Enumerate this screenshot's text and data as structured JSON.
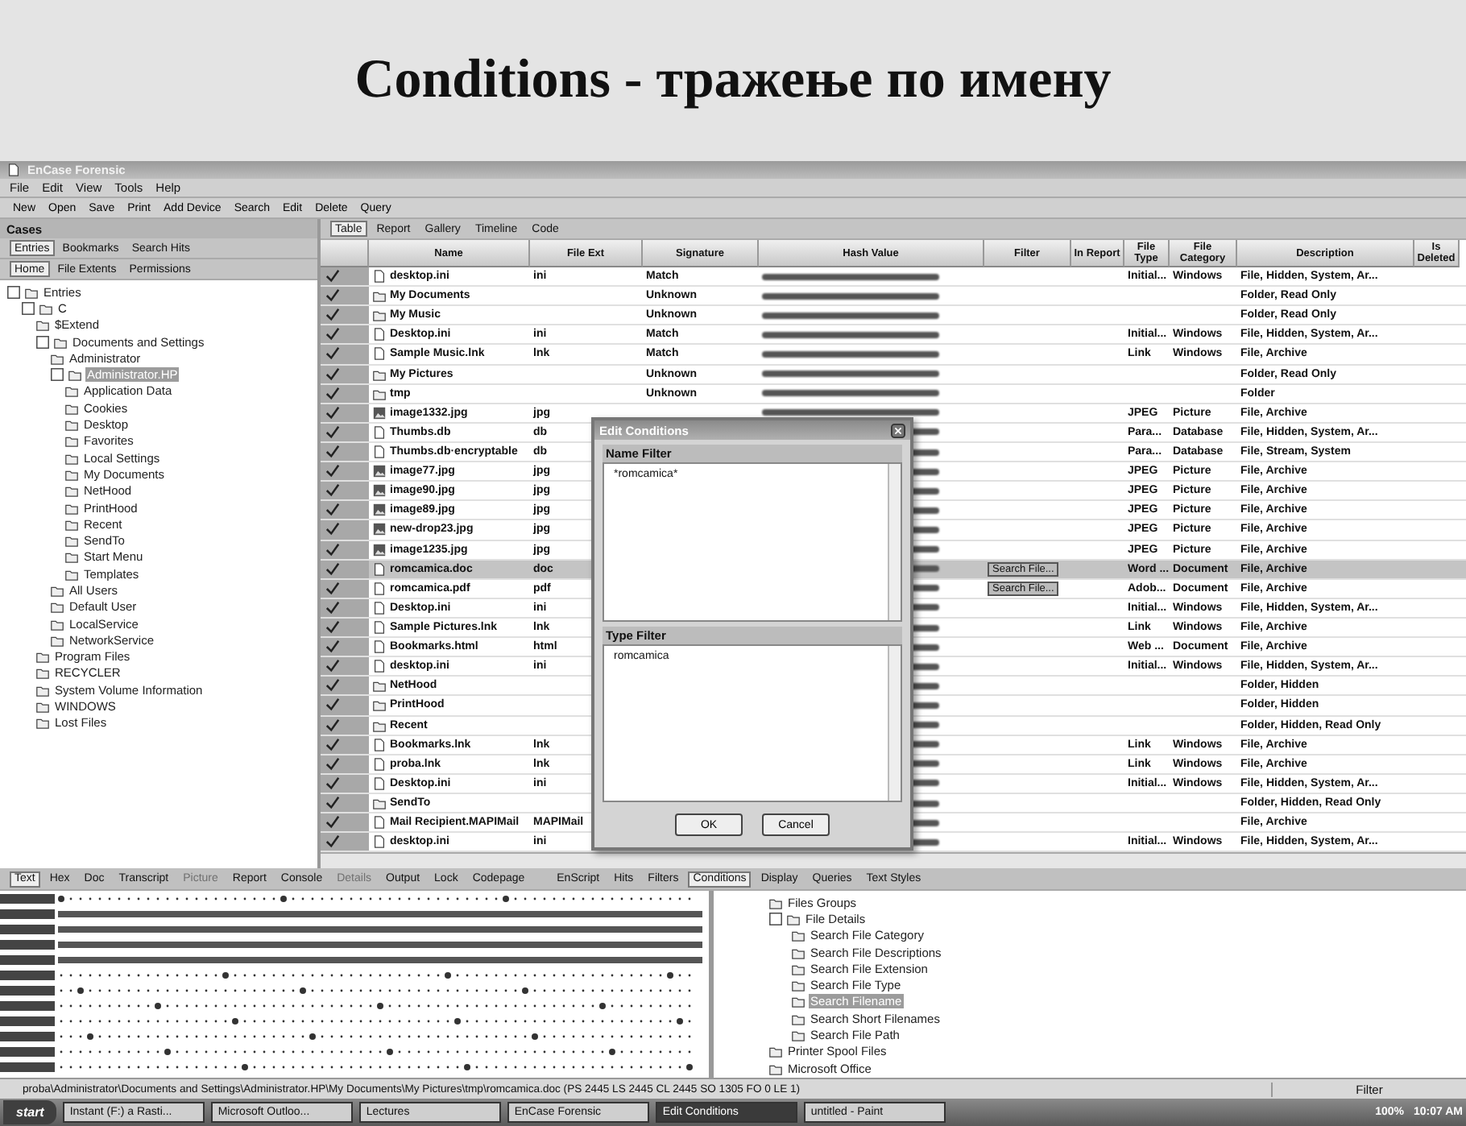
{
  "slide_title": "Conditions - тражење по имену",
  "window": {
    "title": "EnCase Forensic"
  },
  "menu": [
    "File",
    "Edit",
    "View",
    "Tools",
    "Help"
  ],
  "toolbar": [
    "New",
    "Open",
    "Save",
    "Print",
    "Add Device",
    "Search",
    "Edit",
    "Delete",
    "Query"
  ],
  "left_panel": {
    "header": "Cases",
    "tabs_1": [
      {
        "label": "Entries",
        "selected": true
      },
      {
        "label": "Bookmarks",
        "selected": false
      },
      {
        "label": "Search Hits",
        "selected": false
      }
    ],
    "tabs_2": [
      {
        "label": "Home",
        "selected": true
      },
      {
        "label": "File Extents",
        "selected": false
      },
      {
        "label": "Permissions",
        "selected": false
      }
    ],
    "tree": [
      {
        "label": "Entries",
        "selected": false,
        "children": [
          {
            "label": "C",
            "selected": false,
            "children": [
              {
                "label": "$Extend",
                "selected": false
              },
              {
                "label": "Documents and Settings",
                "selected": false,
                "children": [
                  {
                    "label": "Administrator",
                    "selected": false
                  },
                  {
                    "label": "Administrator.HP",
                    "selected": true,
                    "children": [
                      {
                        "label": "Application Data",
                        "selected": false
                      },
                      {
                        "label": "Cookies",
                        "selected": false
                      },
                      {
                        "label": "Desktop",
                        "selected": false
                      },
                      {
                        "label": "Favorites",
                        "selected": false
                      },
                      {
                        "label": "Local Settings",
                        "selected": false
                      },
                      {
                        "label": "My Documents",
                        "selected": false
                      },
                      {
                        "label": "NetHood",
                        "selected": false
                      },
                      {
                        "label": "PrintHood",
                        "selected": false
                      },
                      {
                        "label": "Recent",
                        "selected": false
                      },
                      {
                        "label": "SendTo",
                        "selected": false
                      },
                      {
                        "label": "Start Menu",
                        "selected": false
                      },
                      {
                        "label": "Templates",
                        "selected": false
                      }
                    ]
                  },
                  {
                    "label": "All Users",
                    "selected": false
                  },
                  {
                    "label": "Default User",
                    "selected": false
                  },
                  {
                    "label": "LocalService",
                    "selected": false
                  },
                  {
                    "label": "NetworkService",
                    "selected": false
                  }
                ]
              },
              {
                "label": "Program Files",
                "selected": false
              },
              {
                "label": "RECYCLER",
                "selected": false
              },
              {
                "label": "System Volume Information",
                "selected": false
              },
              {
                "label": "WINDOWS",
                "selected": false
              },
              {
                "label": "Lost Files",
                "selected": false
              }
            ]
          }
        ]
      }
    ]
  },
  "view_tabs": [
    {
      "label": "Table",
      "selected": true
    },
    {
      "label": "Report",
      "selected": false
    },
    {
      "label": "Gallery",
      "selected": false
    },
    {
      "label": "Timeline",
      "selected": false
    },
    {
      "label": "Code",
      "selected": false
    }
  ],
  "table": {
    "columns": [
      "Name",
      "File Ext",
      "Signature",
      "Hash Value",
      "Filter",
      "In Report",
      "File Type",
      "File Category",
      "Description",
      "Is Deleted"
    ],
    "rows": [
      {
        "kind": "file",
        "name": "desktop.ini",
        "ext": "ini",
        "signature": "Match",
        "file_type": "Initial...",
        "category": "Windows",
        "description": "File, Hidden, System, Ar...",
        "selected": false
      },
      {
        "kind": "folder",
        "name": "My Documents",
        "signature": "Unknown",
        "description": "Folder, Read Only",
        "selected": false
      },
      {
        "kind": "folder",
        "name": "My Music",
        "signature": "Unknown",
        "description": "Folder, Read Only",
        "selected": false
      },
      {
        "kind": "file",
        "name": "Desktop.ini",
        "ext": "ini",
        "signature": "Match",
        "file_type": "Initial...",
        "category": "Windows",
        "description": "File, Hidden, System, Ar...",
        "selected": false
      },
      {
        "kind": "file",
        "name": "Sample Music.lnk",
        "ext": "lnk",
        "signature": "Match",
        "file_type": "Link",
        "category": "Windows",
        "description": "File, Archive",
        "selected": false
      },
      {
        "kind": "folder",
        "name": "My Pictures",
        "signature": "Unknown",
        "description": "Folder, Read Only",
        "selected": false
      },
      {
        "kind": "folder",
        "name": "tmp",
        "signature": "Unknown",
        "description": "Folder",
        "selected": false
      },
      {
        "kind": "image",
        "name": "image1332.jpg",
        "ext": "jpg",
        "file_type": "JPEG",
        "category": "Picture",
        "description": "File, Archive",
        "selected": false
      },
      {
        "kind": "file",
        "name": "Thumbs.db",
        "ext": "db",
        "file_type": "Para...",
        "category": "Database",
        "description": "File, Hidden, System, Ar...",
        "selected": false
      },
      {
        "kind": "file",
        "name": "Thumbs.db·encryptable",
        "ext": "db",
        "file_type": "Para...",
        "category": "Database",
        "description": "File, Stream, System",
        "selected": false
      },
      {
        "kind": "image",
        "name": "image77.jpg",
        "ext": "jpg",
        "file_type": "JPEG",
        "category": "Picture",
        "description": "File, Archive",
        "selected": false
      },
      {
        "kind": "image",
        "name": "image90.jpg",
        "ext": "jpg",
        "file_type": "JPEG",
        "category": "Picture",
        "description": "File, Archive",
        "selected": false
      },
      {
        "kind": "image",
        "name": "image89.jpg",
        "ext": "jpg",
        "file_type": "JPEG",
        "category": "Picture",
        "description": "File, Archive",
        "selected": false
      },
      {
        "kind": "image",
        "name": "new-drop23.jpg",
        "ext": "jpg",
        "file_type": "JPEG",
        "category": "Picture",
        "description": "File, Archive",
        "selected": false
      },
      {
        "kind": "image",
        "name": "image1235.jpg",
        "ext": "jpg",
        "file_type": "JPEG",
        "category": "Picture",
        "description": "File, Archive",
        "selected": false
      },
      {
        "kind": "file",
        "name": "romcamica.doc",
        "ext": "doc",
        "filter": "Search File...",
        "file_type": "Word ...",
        "category": "Document",
        "description": "File, Archive",
        "selected": true
      },
      {
        "kind": "file",
        "name": "romcamica.pdf",
        "ext": "pdf",
        "filter": "Search File...",
        "file_type": "Adob...",
        "category": "Document",
        "description": "File, Archive",
        "selected": false
      },
      {
        "kind": "file",
        "name": "Desktop.ini",
        "ext": "ini",
        "file_type": "Initial...",
        "category": "Windows",
        "description": "File, Hidden, System, Ar...",
        "selected": false
      },
      {
        "kind": "file",
        "name": "Sample Pictures.lnk",
        "ext": "lnk",
        "file_type": "Link",
        "category": "Windows",
        "description": "File, Archive",
        "selected": false
      },
      {
        "kind": "file",
        "name": "Bookmarks.html",
        "ext": "html",
        "file_type": "Web ...",
        "category": "Document",
        "description": "File, Archive",
        "selected": false
      },
      {
        "kind": "file",
        "name": "desktop.ini",
        "ext": "ini",
        "file_type": "Initial...",
        "category": "Windows",
        "description": "File, Hidden, System, Ar...",
        "selected": false
      },
      {
        "kind": "folder",
        "name": "NetHood",
        "description": "Folder, Hidden",
        "selected": false
      },
      {
        "kind": "folder",
        "name": "PrintHood",
        "description": "Folder, Hidden",
        "selected": false
      },
      {
        "kind": "folder",
        "name": "Recent",
        "description": "Folder, Hidden, Read Only",
        "selected": false
      },
      {
        "kind": "file",
        "name": "Bookmarks.lnk",
        "ext": "lnk",
        "file_type": "Link",
        "category": "Windows",
        "description": "File, Archive",
        "selected": false
      },
      {
        "kind": "file",
        "name": "proba.lnk",
        "ext": "lnk",
        "file_type": "Link",
        "category": "Windows",
        "description": "File, Archive",
        "selected": false
      },
      {
        "kind": "file",
        "name": "Desktop.ini",
        "ext": "ini",
        "file_type": "Initial...",
        "category": "Windows",
        "description": "File, Hidden, System, Ar...",
        "selected": false
      },
      {
        "kind": "folder",
        "name": "SendTo",
        "description": "Folder, Hidden, Read Only",
        "selected": false
      },
      {
        "kind": "file",
        "name": "Mail Recipient.MAPIMail",
        "ext": "MAPIMail",
        "description": "File, Archive",
        "selected": false
      },
      {
        "kind": "file",
        "name": "desktop.ini",
        "ext": "ini",
        "file_type": "Initial...",
        "category": "Windows",
        "description": "File, Hidden, System, Ar...",
        "selected": false
      }
    ]
  },
  "dialog": {
    "title": "Edit Conditions",
    "sections": [
      {
        "label": "Name Filter",
        "value": "*romcamica*"
      },
      {
        "label": "Type Filter",
        "value": "romcamica"
      }
    ],
    "buttons": [
      "OK",
      "Cancel"
    ]
  },
  "bottom_left_tabs": [
    {
      "label": "Text",
      "selected": true,
      "disabled": false
    },
    {
      "label": "Hex",
      "selected": false,
      "disabled": false
    },
    {
      "label": "Doc",
      "selected": false,
      "disabled": false
    },
    {
      "label": "Transcript",
      "selected": false,
      "disabled": false
    },
    {
      "label": "Picture",
      "selected": false,
      "disabled": true
    },
    {
      "label": "Report",
      "selected": false,
      "disabled": false
    },
    {
      "label": "Console",
      "selected": false,
      "disabled": false
    },
    {
      "label": "Details",
      "selected": false,
      "disabled": true
    },
    {
      "label": "Output",
      "selected": false,
      "disabled": false
    },
    {
      "label": "Lock",
      "selected": false,
      "disabled": false
    },
    {
      "label": "Codepage",
      "selected": false,
      "disabled": false
    }
  ],
  "bottom_right_tabs": [
    {
      "label": "EnScript",
      "selected": false
    },
    {
      "label": "Hits",
      "selected": false
    },
    {
      "label": "Filters",
      "selected": false
    },
    {
      "label": "Conditions",
      "selected": true
    },
    {
      "label": "Display",
      "selected": false
    },
    {
      "label": "Queries",
      "selected": false
    },
    {
      "label": "Text Styles",
      "selected": false
    }
  ],
  "conditions_tree": [
    {
      "label": "Files Groups",
      "selected": false
    },
    {
      "label": "File Details",
      "selected": false,
      "children": [
        {
          "label": "Search File Category",
          "selected": false
        },
        {
          "label": "Search File Descriptions",
          "selected": false
        },
        {
          "label": "Search File Extension",
          "selected": false
        },
        {
          "label": "Search File Type",
          "selected": false
        },
        {
          "label": "Search Filename",
          "selected": true
        },
        {
          "label": "Search Short Filenames",
          "selected": false
        },
        {
          "label": "Search File Path",
          "selected": false
        }
      ]
    },
    {
      "label": "Printer Spool Files",
      "selected": false
    },
    {
      "label": "Microsoft Office",
      "selected": false
    }
  ],
  "status_bar": {
    "path": "proba\\Administrator\\Documents and Settings\\Administrator.HP\\My Documents\\My Pictures\\tmp\\romcamica.doc (PS 2445 LS 2445 CL 2445 SO 1305 FO 0 LE 1)",
    "right": "Filter"
  },
  "taskbar": {
    "start": "start",
    "items": [
      {
        "label": "Instant (F:) a Rasti...",
        "selected": false
      },
      {
        "label": "Microsoft Outloo...",
        "selected": false
      },
      {
        "label": "Lectures",
        "selected": false
      },
      {
        "label": "EnCase Forensic",
        "selected": false
      },
      {
        "label": "Edit Conditions",
        "selected": true
      },
      {
        "label": "untitled - Paint",
        "selected": false
      }
    ],
    "zoom": "100%",
    "clock": "10:07 AM"
  }
}
